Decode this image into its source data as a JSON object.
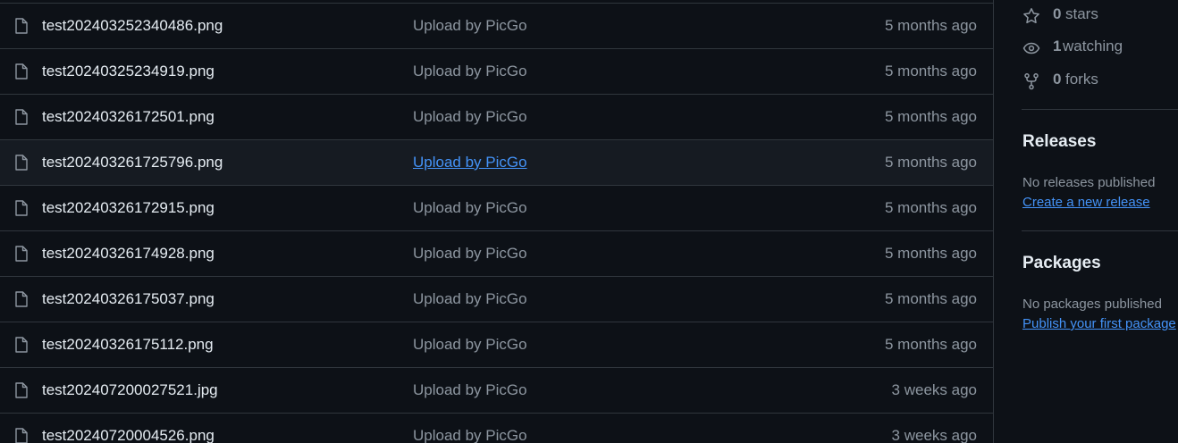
{
  "files": [
    {
      "name": "test202403252340486.png",
      "message": "Upload by PicGo",
      "age": "5 months ago"
    },
    {
      "name": "test20240325234919.png",
      "message": "Upload by PicGo",
      "age": "5 months ago"
    },
    {
      "name": "test20240326172501.png",
      "message": "Upload by PicGo",
      "age": "5 months ago"
    },
    {
      "name": "test202403261725796.png",
      "message": "Upload by PicGo",
      "age": "5 months ago"
    },
    {
      "name": "test20240326172915.png",
      "message": "Upload by PicGo",
      "age": "5 months ago"
    },
    {
      "name": "test20240326174928.png",
      "message": "Upload by PicGo",
      "age": "5 months ago"
    },
    {
      "name": "test20240326175037.png",
      "message": "Upload by PicGo",
      "age": "5 months ago"
    },
    {
      "name": "test20240326175112.png",
      "message": "Upload by PicGo",
      "age": "5 months ago"
    },
    {
      "name": "test202407200027521.jpg",
      "message": "Upload by PicGo",
      "age": "3 weeks ago"
    },
    {
      "name": "test20240720004526.png",
      "message": "Upload by PicGo",
      "age": "3 weeks ago"
    }
  ],
  "sidebar": {
    "stars": {
      "count": "0",
      "label": "stars",
      "icon": "star-icon"
    },
    "watching": {
      "count": "1",
      "label": "watching",
      "icon": "eye-icon"
    },
    "forks": {
      "count": "0",
      "label": "forks",
      "icon": "fork-icon"
    },
    "releases": {
      "title": "Releases",
      "empty_text": "No releases published",
      "link": "Create a new release"
    },
    "packages": {
      "title": "Packages",
      "empty_text": "No packages published",
      "link": "Publish your first package"
    }
  },
  "colors": {
    "background": "#0d1117",
    "border": "#30363d",
    "text": "#e6edf3",
    "muted": "#8d96a0",
    "link": "#4493f8",
    "hover_row": "#161b22"
  }
}
